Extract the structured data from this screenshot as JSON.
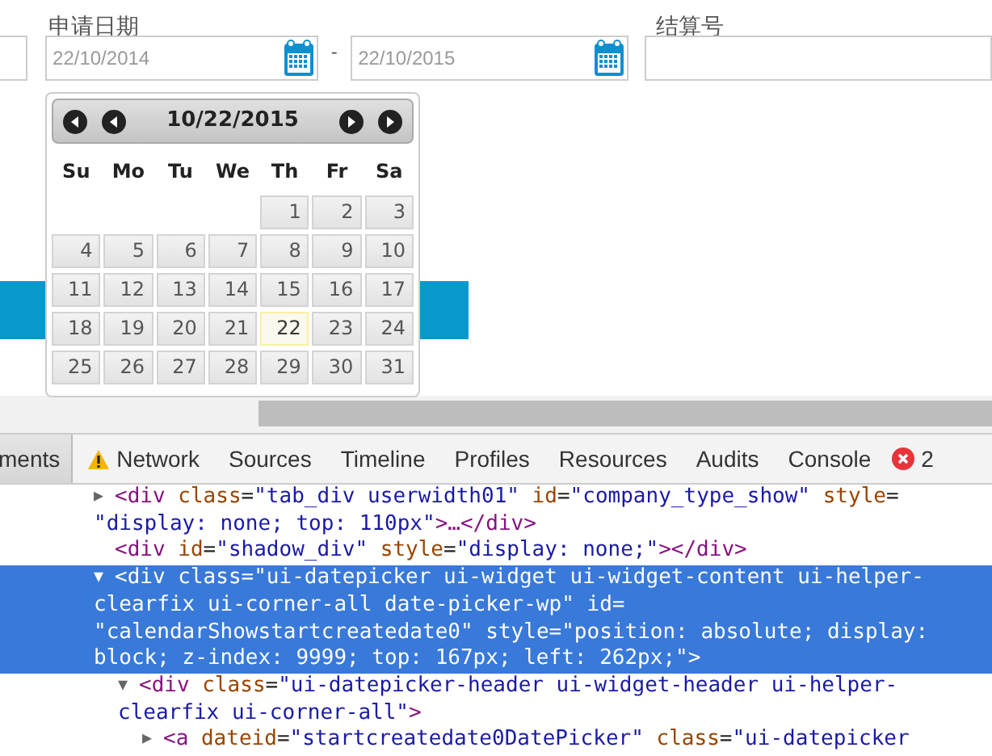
{
  "date_range": {
    "label": "申请日期",
    "from": {
      "value": "22/10/2014"
    },
    "separator": "-",
    "to": {
      "value": "22/10/2015"
    }
  },
  "settlement": {
    "label": "结算号"
  },
  "datepicker": {
    "title": "10/22/2015",
    "weekdays": [
      "Su",
      "Mo",
      "Tu",
      "We",
      "Th",
      "Fr",
      "Sa"
    ],
    "weeks": [
      [
        {
          "label": "1",
          "today": false
        },
        {
          "label": "2",
          "today": false
        },
        {
          "label": "3",
          "today": false
        }
      ],
      [
        {
          "label": "4",
          "today": false
        },
        {
          "label": "5",
          "today": false
        },
        {
          "label": "6",
          "today": false
        },
        {
          "label": "7",
          "today": false
        },
        {
          "label": "8",
          "today": false
        },
        {
          "label": "9",
          "today": false
        },
        {
          "label": "10",
          "today": false
        }
      ],
      [
        {
          "label": "11",
          "today": false
        },
        {
          "label": "12",
          "today": false
        },
        {
          "label": "13",
          "today": false
        },
        {
          "label": "14",
          "today": false
        },
        {
          "label": "15",
          "today": false
        },
        {
          "label": "16",
          "today": false
        },
        {
          "label": "17",
          "today": false
        }
      ],
      [
        {
          "label": "18",
          "today": false
        },
        {
          "label": "19",
          "today": false
        },
        {
          "label": "20",
          "today": false
        },
        {
          "label": "21",
          "today": false
        },
        {
          "label": "22",
          "today": true
        },
        {
          "label": "23",
          "today": false
        },
        {
          "label": "24",
          "today": false
        }
      ],
      [
        {
          "label": "25",
          "today": false
        },
        {
          "label": "26",
          "today": false
        },
        {
          "label": "27",
          "today": false
        },
        {
          "label": "28",
          "today": false
        },
        {
          "label": "29",
          "today": false
        },
        {
          "label": "30",
          "today": false
        },
        {
          "label": "31",
          "today": false
        }
      ]
    ]
  },
  "devtools": {
    "tabs": [
      {
        "label": "ments",
        "selected": true,
        "kind": "plain"
      },
      {
        "label": "Network",
        "selected": false,
        "kind": "warning"
      },
      {
        "label": "Sources",
        "selected": false,
        "kind": "plain"
      },
      {
        "label": "Timeline",
        "selected": false,
        "kind": "plain"
      },
      {
        "label": "Profiles",
        "selected": false,
        "kind": "plain"
      },
      {
        "label": "Resources",
        "selected": false,
        "kind": "plain"
      },
      {
        "label": "Audits",
        "selected": false,
        "kind": "plain"
      },
      {
        "label": "Console",
        "selected": false,
        "kind": "plain"
      }
    ],
    "error_count": "2",
    "dom_tree": [
      {
        "expander": "▶",
        "selected": false,
        "lines": [
          [
            {
              "kind": "tag",
              "text": "<div"
            },
            {
              "kind": "attr",
              "text": " class"
            },
            {
              "kind": "plain",
              "text": "="
            },
            {
              "kind": "value",
              "text": "\"tab_div userwidth01\""
            },
            {
              "kind": "attr",
              "text": " id"
            },
            {
              "kind": "plain",
              "text": "="
            },
            {
              "kind": "value",
              "text": "\"company_type_show\""
            },
            {
              "kind": "attr",
              "text": " style"
            },
            {
              "kind": "plain",
              "text": "="
            }
          ],
          [
            {
              "kind": "value",
              "text": "\"display: none; top: 110px\""
            },
            {
              "kind": "tag",
              "text": ">…</div>"
            }
          ]
        ]
      },
      {
        "selected": false,
        "lines": [
          [
            {
              "kind": "tag",
              "text": "<div"
            },
            {
              "kind": "attr",
              "text": " id"
            },
            {
              "kind": "plain",
              "text": "="
            },
            {
              "kind": "value",
              "text": "\"shadow_div\""
            },
            {
              "kind": "attr",
              "text": " style"
            },
            {
              "kind": "plain",
              "text": "="
            },
            {
              "kind": "value",
              "text": "\"display: none;\""
            },
            {
              "kind": "tag",
              "text": "></div>"
            }
          ]
        ]
      },
      {
        "expander": "▼",
        "selected": true,
        "lines": [
          [
            {
              "kind": "tag",
              "text": "<div"
            },
            {
              "kind": "attr",
              "text": " class"
            },
            {
              "kind": "plain",
              "text": "="
            },
            {
              "kind": "value",
              "text": "\"ui-datepicker ui-widget ui-widget-content ui-helper-"
            }
          ],
          [
            {
              "kind": "value",
              "text": "clearfix ui-corner-all date-picker-wp\""
            },
            {
              "kind": "attr",
              "text": " id"
            },
            {
              "kind": "plain",
              "text": "="
            }
          ],
          [
            {
              "kind": "value",
              "text": "\"calendarShowstartcreatedate0\""
            },
            {
              "kind": "attr",
              "text": " style"
            },
            {
              "kind": "plain",
              "text": "="
            },
            {
              "kind": "value",
              "text": "\"position: absolute; display:"
            }
          ],
          [
            {
              "kind": "value",
              "text": "block; z-index: 9999; top: 167px; left: 262px;\""
            },
            {
              "kind": "tag",
              "text": ">"
            }
          ]
        ],
        "children": [
          {
            "expander": "▼",
            "selected": false,
            "lines": [
              [
                {
                  "kind": "tag",
                  "text": "<div"
                },
                {
                  "kind": "attr",
                  "text": " class"
                },
                {
                  "kind": "plain",
                  "text": "="
                },
                {
                  "kind": "value",
                  "text": "\"ui-datepicker-header ui-widget-header ui-helper-"
                }
              ],
              [
                {
                  "kind": "value",
                  "text": "clearfix ui-corner-all\""
                },
                {
                  "kind": "tag",
                  "text": ">"
                }
              ]
            ],
            "children": [
              {
                "expander": "▶",
                "selected": false,
                "lines": [
                  [
                    {
                      "kind": "tag",
                      "text": "<a"
                    },
                    {
                      "kind": "attr",
                      "text": " dateid"
                    },
                    {
                      "kind": "plain",
                      "text": "="
                    },
                    {
                      "kind": "value",
                      "text": "\"startcreatedate0DatePicker\""
                    },
                    {
                      "kind": "attr",
                      "text": " class"
                    },
                    {
                      "kind": "plain",
                      "text": "="
                    },
                    {
                      "kind": "value",
                      "text": "\"ui-datepicker"
                    }
                  ]
                ]
              }
            ]
          }
        ]
      }
    ]
  }
}
